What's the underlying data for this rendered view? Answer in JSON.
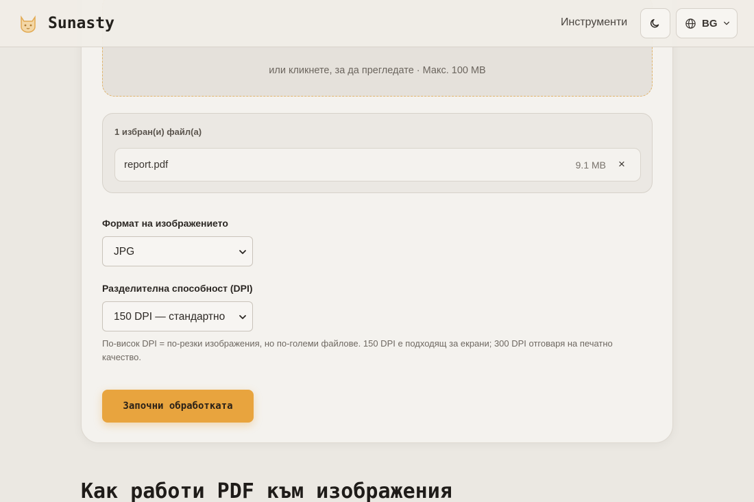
{
  "header": {
    "brand": "Sunasty",
    "nav_tools": "Инструменти",
    "language": "BG"
  },
  "upload": {
    "hint": "или кликнете, за да прегледате · Макс. 100 MB"
  },
  "files": {
    "count_label": "1 избран(и) файл(а)",
    "items": [
      {
        "name": "report.pdf",
        "size": "9.1 MB",
        "remove": "×"
      }
    ]
  },
  "format": {
    "label": "Формат на изображението",
    "selected": "JPG"
  },
  "dpi": {
    "label": "Разделителна способност (DPI)",
    "selected": "150 DPI — стандартно",
    "help": "По-висок DPI = по-резки изображения, но по-големи файлове. 150 DPI е подходящ за екрани; 300 DPI отговаря на печатно качество."
  },
  "actions": {
    "start_label": "Започни обработката"
  },
  "section": {
    "title": "Как работи PDF към изображения"
  },
  "colors": {
    "accent": "#e8a43e",
    "dropzone_border": "#e0b36a",
    "background": "#ebe8e2"
  },
  "icons": {
    "logo": "cat-logo-icon",
    "theme": "moon-icon",
    "language": "globe-icon",
    "dropdown": "chevron-down-icon",
    "remove": "close-icon"
  }
}
